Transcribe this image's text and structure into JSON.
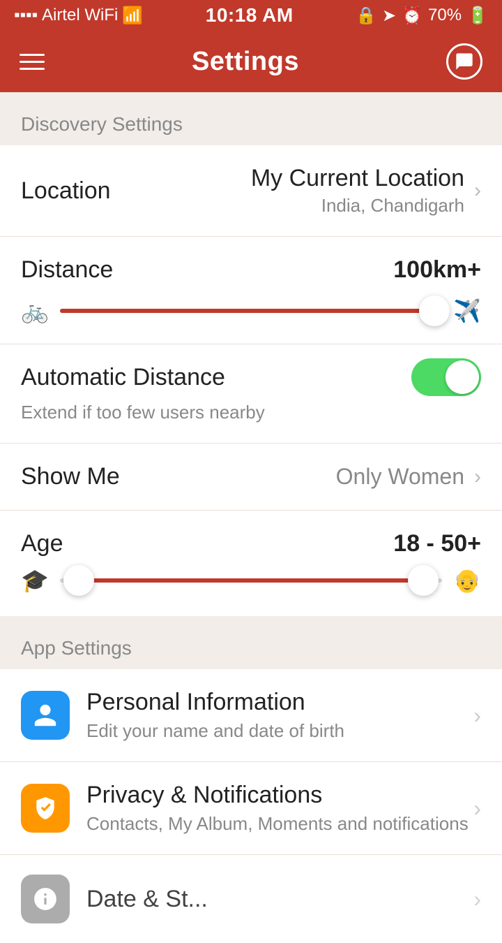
{
  "statusBar": {
    "carrier": "Airtel WiFi",
    "time": "10:18 AM",
    "battery": "70%",
    "batteryIcon": "🔋"
  },
  "navBar": {
    "title": "Settings",
    "menuIcon": "menu-icon",
    "chatIcon": "chat-icon"
  },
  "discoverySettings": {
    "sectionLabel": "Discovery Settings",
    "location": {
      "label": "Location",
      "valuePrimary": "My Current Location",
      "valueSub": "India, Chandigarh"
    },
    "distance": {
      "label": "Distance",
      "value": "100km+",
      "sliderPercent": 98,
      "leftIcon": "🚲",
      "rightIcon": "✈️"
    },
    "automaticDistance": {
      "label": "Automatic Distance",
      "sub": "Extend if too few users nearby",
      "enabled": true
    },
    "showMe": {
      "label": "Show Me",
      "value": "Only Women",
      "chevron": ">"
    },
    "age": {
      "label": "Age",
      "value": "18 - 50+",
      "leftThumbPercent": 5,
      "rightThumbPercent": 95,
      "leftIcon": "🎓",
      "rightIcon": "👴"
    }
  },
  "appSettings": {
    "sectionLabel": "App Settings",
    "items": [
      {
        "iconColor": "blue",
        "iconEmoji": "👤",
        "title": "Personal Information",
        "sub": "Edit your name and date of birth"
      },
      {
        "iconColor": "orange",
        "iconEmoji": "🤚",
        "title": "Privacy & Notifications",
        "sub": "Contacts, My Album, Moments and notifications"
      },
      {
        "iconColor": "gray",
        "iconEmoji": "⚙️",
        "title": "Date & St...",
        "sub": ""
      }
    ]
  }
}
